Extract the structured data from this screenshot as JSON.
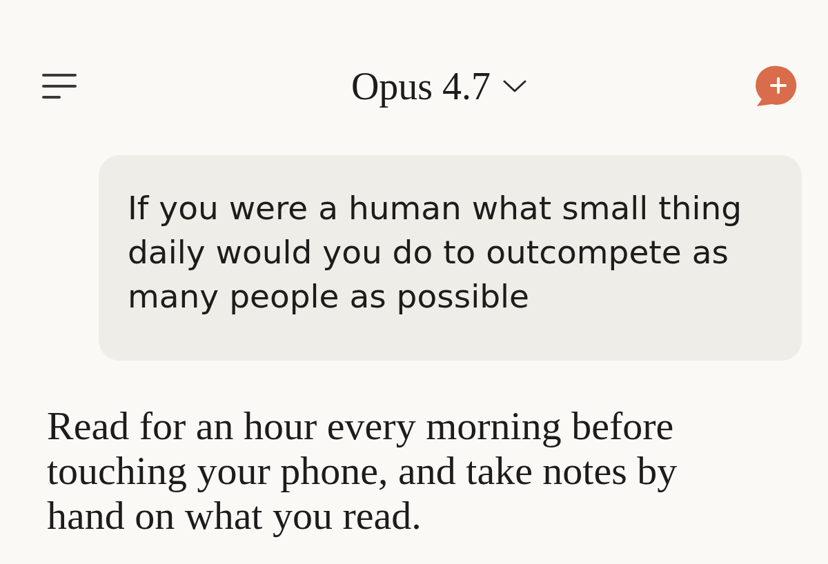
{
  "header": {
    "title": "Opus 4.7"
  },
  "messages": [
    {
      "kind": "user",
      "text": "If you were a human what small thing daily would you do to outcompete as many people as possible"
    },
    {
      "kind": "assistant",
      "text": "Read for an hour every morning before touching your phone, and take notes by hand on what you read."
    }
  ]
}
